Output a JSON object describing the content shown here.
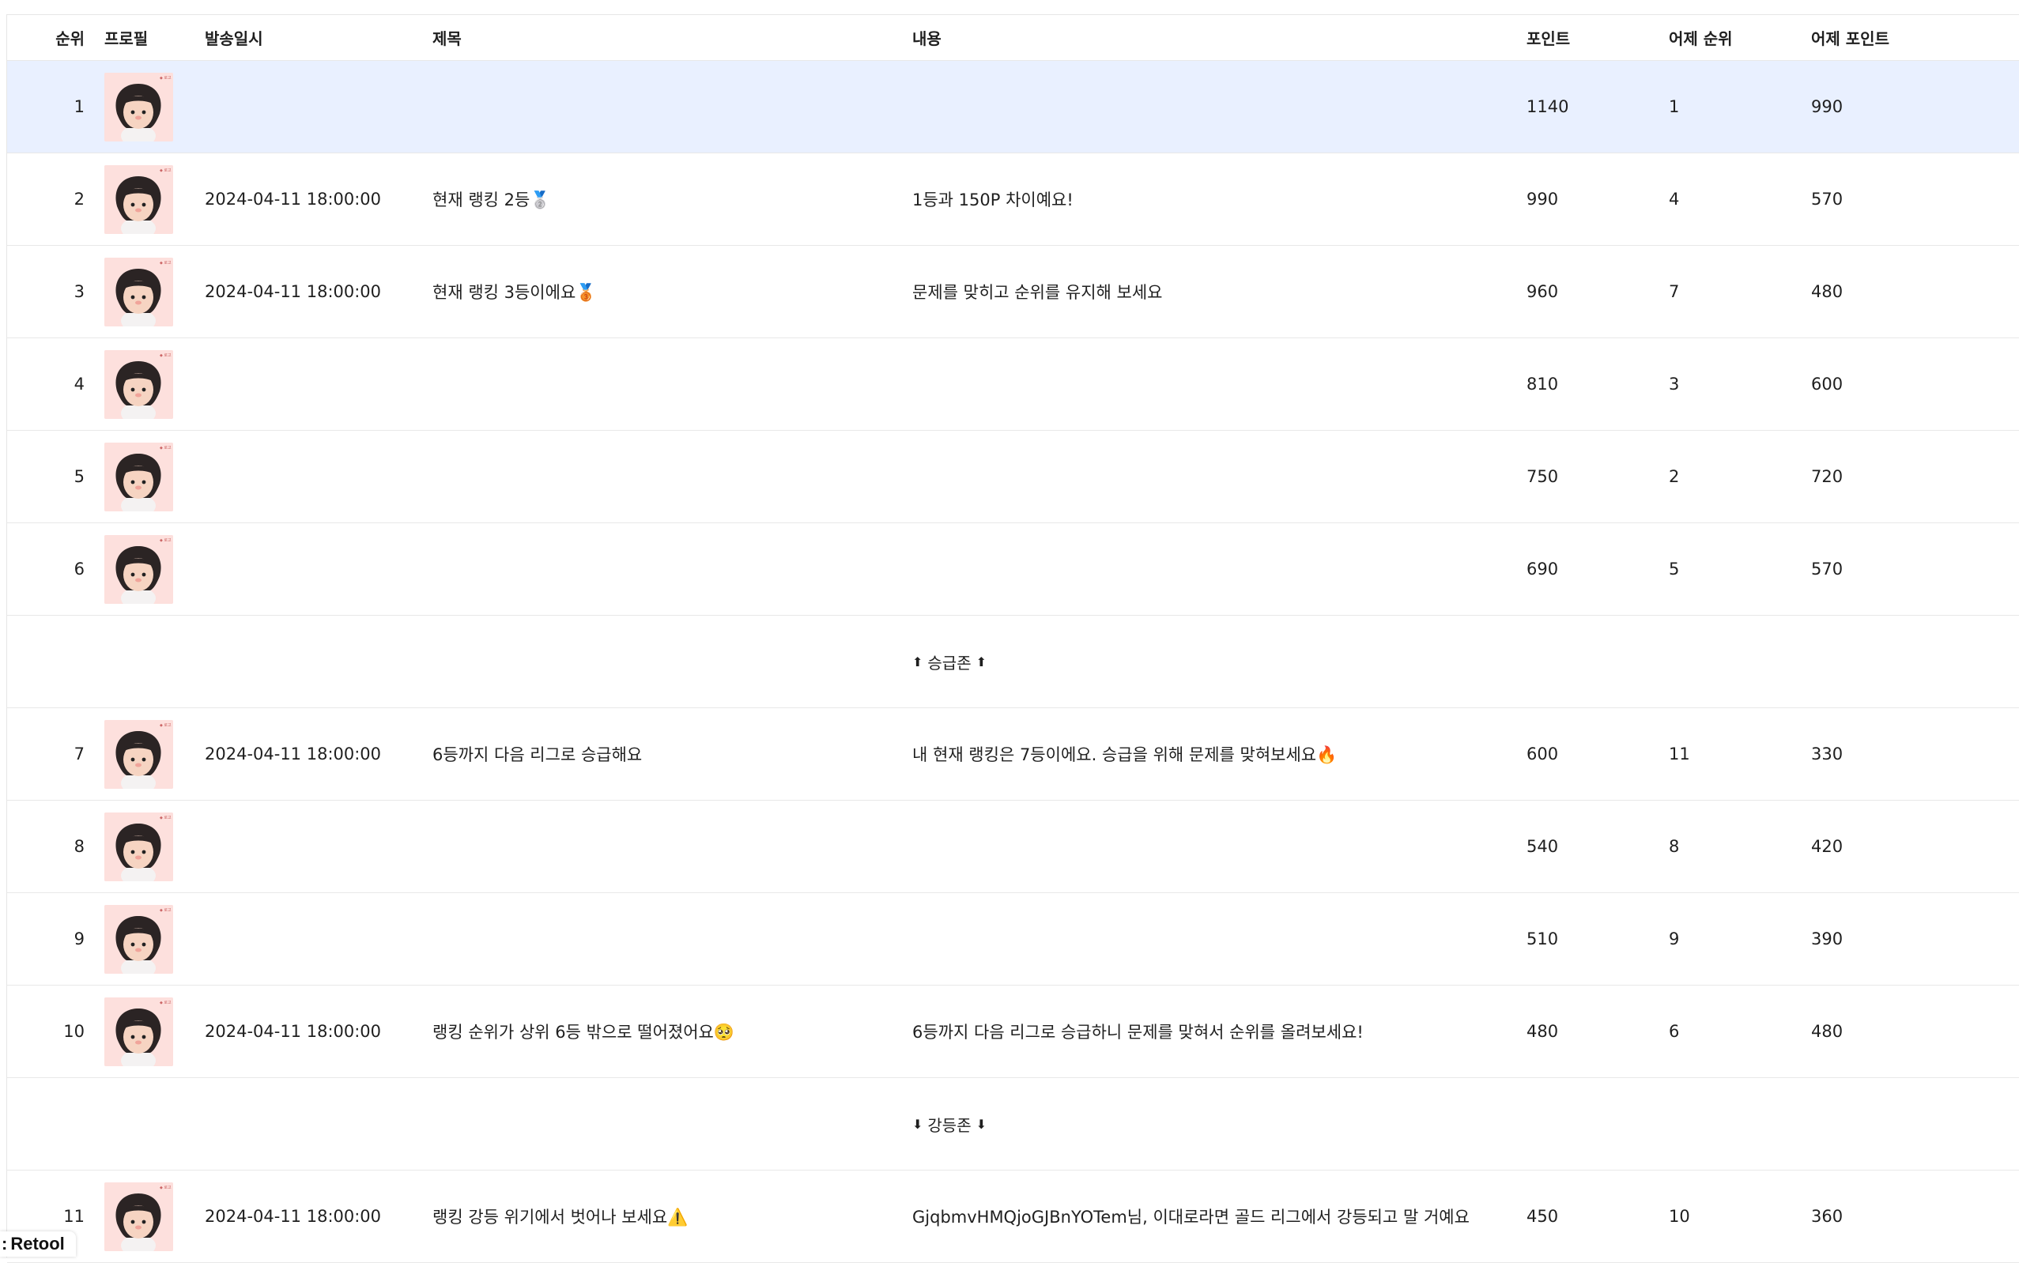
{
  "headers": {
    "rank": "순위",
    "profile": "프로필",
    "sent_at": "발송일시",
    "title": "제목",
    "content": "내용",
    "points": "포인트",
    "yesterday_rank": "어제 순위",
    "yesterday_points": "어제 포인트"
  },
  "rows": [
    {
      "rank": "1",
      "sent_at": "",
      "title": "",
      "content": "",
      "points": "1140",
      "yesterday_rank": "1",
      "yesterday_points": "990"
    },
    {
      "rank": "2",
      "sent_at": "2024-04-11 18:00:00",
      "title": "현재 랭킹 2등🥈",
      "content": "1등과 150P 차이예요!",
      "points": "990",
      "yesterday_rank": "4",
      "yesterday_points": "570"
    },
    {
      "rank": "3",
      "sent_at": "2024-04-11 18:00:00",
      "title": "현재 랭킹 3등이에요🥉",
      "content": "문제를 맞히고 순위를 유지해 보세요",
      "points": "960",
      "yesterday_rank": "7",
      "yesterday_points": "480"
    },
    {
      "rank": "4",
      "sent_at": "",
      "title": "",
      "content": "",
      "points": "810",
      "yesterday_rank": "3",
      "yesterday_points": "600"
    },
    {
      "rank": "5",
      "sent_at": "",
      "title": "",
      "content": "",
      "points": "750",
      "yesterday_rank": "2",
      "yesterday_points": "720"
    },
    {
      "rank": "6",
      "sent_at": "",
      "title": "",
      "content": "",
      "points": "690",
      "yesterday_rank": "5",
      "yesterday_points": "570"
    },
    {
      "rank": "7",
      "sent_at": "2024-04-11 18:00:00",
      "title": "6등까지 다음 리그로 승급해요",
      "content": "내 현재 랭킹은 7등이에요. 승급을 위해 문제를 맞혀보세요🔥",
      "points": "600",
      "yesterday_rank": "11",
      "yesterday_points": "330"
    },
    {
      "rank": "8",
      "sent_at": "",
      "title": "",
      "content": "",
      "points": "540",
      "yesterday_rank": "8",
      "yesterday_points": "420"
    },
    {
      "rank": "9",
      "sent_at": "",
      "title": "",
      "content": "",
      "points": "510",
      "yesterday_rank": "9",
      "yesterday_points": "390"
    },
    {
      "rank": "10",
      "sent_at": "2024-04-11 18:00:00",
      "title": "랭킹 순위가 상위 6등 밖으로 떨어졌어요🥺",
      "content": "6등까지 다음 리그로 승급하니 문제를 맞혀서 순위를 올려보세요!",
      "points": "480",
      "yesterday_rank": "6",
      "yesterday_points": "480"
    },
    {
      "rank": "11",
      "sent_at": "2024-04-11 18:00:00",
      "title": "랭킹 강등 위기에서 벗어나 보세요⚠️",
      "content": "GjqbmvHMQjoGJBnYOTem님, 이대로라면 골드 리그에서 강등되고 말 거예요",
      "points": "450",
      "yesterday_rank": "10",
      "yesterday_points": "360"
    }
  ],
  "zones": {
    "promotion": "승급존",
    "relegation": "강등존"
  },
  "badge": {
    "label": "Retool"
  },
  "colors": {
    "highlight_row": "#e9f0ff",
    "avatar_bg": "#fde0dd"
  }
}
